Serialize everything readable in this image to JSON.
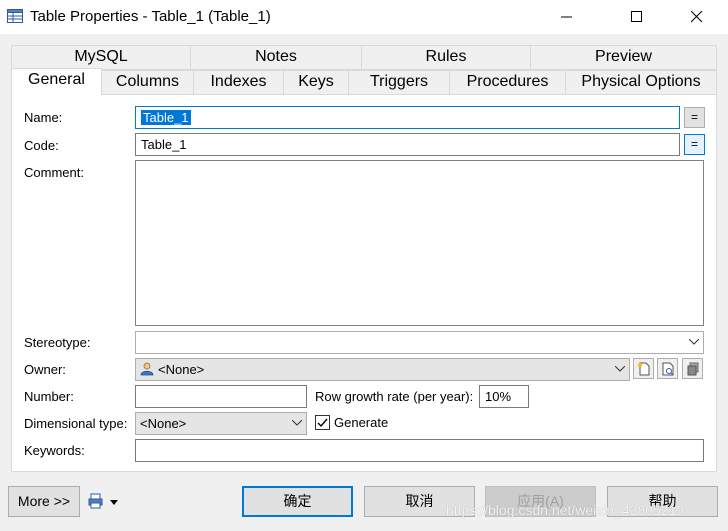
{
  "window": {
    "title": "Table Properties - Table_1 (Table_1)"
  },
  "tabs_row1": [
    {
      "label": "MySQL"
    },
    {
      "label": "Notes"
    },
    {
      "label": "Rules"
    },
    {
      "label": "Preview"
    }
  ],
  "tabs_row2": [
    {
      "label": "General",
      "active": true
    },
    {
      "label": "Columns"
    },
    {
      "label": "Indexes"
    },
    {
      "label": "Keys"
    },
    {
      "label": "Triggers"
    },
    {
      "label": "Procedures"
    },
    {
      "label": "Physical Options"
    }
  ],
  "form": {
    "name_label": "Name:",
    "name_value": "Table_1",
    "code_label": "Code:",
    "code_value": "Table_1",
    "equal_label": "=",
    "comment_label": "Comment:",
    "comment_value": "",
    "stereotype_label": "Stereotype:",
    "stereotype_value": "",
    "owner_label": "Owner:",
    "owner_value": "<None>",
    "number_label": "Number:",
    "number_value": "",
    "row_growth_label": "Row growth rate (per year):",
    "row_growth_value": "10%",
    "dimensional_label": "Dimensional type:",
    "dimensional_value": "<None>",
    "generate_label": "Generate",
    "generate_checked": true,
    "keywords_label": "Keywords:",
    "keywords_value": ""
  },
  "footer": {
    "more_label": "More >>",
    "ok_label": "确定",
    "cancel_label": "取消",
    "apply_label": "应用(A)",
    "help_label": "帮助"
  },
  "watermark": "https://blog.csdn.net/weixin_43805219",
  "colors": {
    "accent": "#0078d7",
    "panel_bg": "#ffffff",
    "window_bg": "#f0f0f0"
  }
}
